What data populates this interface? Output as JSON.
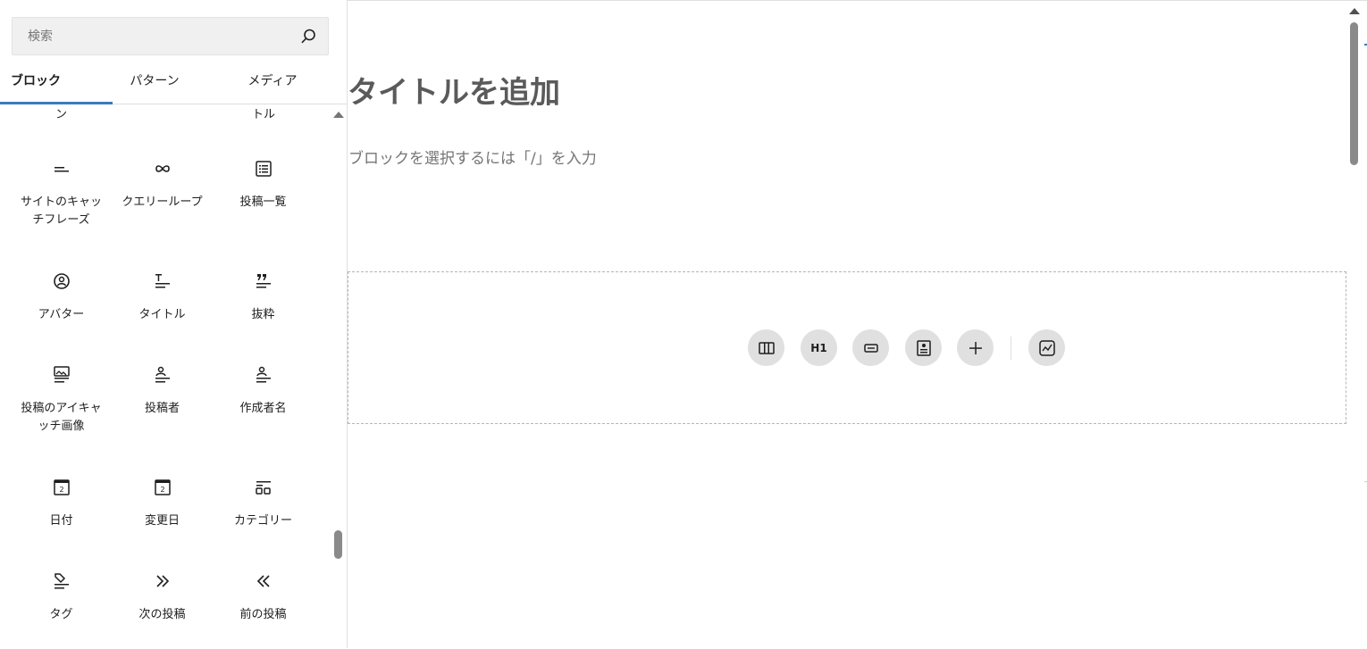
{
  "inserter": {
    "search": {
      "placeholder": "検索",
      "icon": "search-icon"
    },
    "tabs": [
      {
        "label": "ブロック",
        "active": true
      },
      {
        "label": "パターン",
        "active": false
      },
      {
        "label": "メディア",
        "active": false
      }
    ],
    "partial_labels": [
      "ン",
      "トル"
    ],
    "blocks": [
      {
        "label": "サイトのキャッチフレーズ",
        "icon": "site-tagline-icon"
      },
      {
        "label": "クエリーループ",
        "icon": "query-loop-icon"
      },
      {
        "label": "投稿一覧",
        "icon": "post-list-icon"
      },
      {
        "label": "アバター",
        "icon": "avatar-icon"
      },
      {
        "label": "タイトル",
        "icon": "post-title-icon"
      },
      {
        "label": "抜粋",
        "icon": "excerpt-icon"
      },
      {
        "label": "投稿のアイキャッチ画像",
        "icon": "featured-image-icon"
      },
      {
        "label": "投稿者",
        "icon": "author-icon"
      },
      {
        "label": "作成者名",
        "icon": "author-name-icon"
      },
      {
        "label": "日付",
        "icon": "date-icon"
      },
      {
        "label": "変更日",
        "icon": "modified-date-icon"
      },
      {
        "label": "カテゴリー",
        "icon": "categories-icon"
      },
      {
        "label": "タグ",
        "icon": "tag-icon"
      },
      {
        "label": "次の投稿",
        "icon": "next-post-icon"
      },
      {
        "label": "前の投稿",
        "icon": "previous-post-icon"
      }
    ]
  },
  "editor": {
    "title_placeholder": "タイトルを追加",
    "appender_placeholder": "ブロックを選択するには「/」を入力",
    "placeholder_buttons": [
      {
        "icon": "columns-icon"
      },
      {
        "icon": "heading-icon",
        "text": "H1"
      },
      {
        "icon": "button-block-icon"
      },
      {
        "icon": "media-text-icon"
      },
      {
        "icon": "plus-icon"
      },
      {
        "icon": "chart-icon"
      }
    ]
  },
  "colors": {
    "accent": "#3a7bbf",
    "placeholder_text": "#757575",
    "title_text": "#5a5a5a"
  }
}
